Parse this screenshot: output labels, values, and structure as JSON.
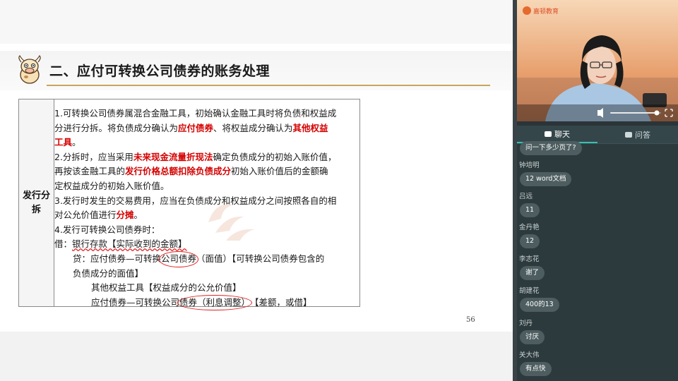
{
  "slide": {
    "title": "二、应付可转换公司债券的账务处理",
    "row_header": "发行分拆",
    "page_number": "56",
    "body": {
      "p1": {
        "a": "1.可转换公司债券属混合金融工具，初始确认金融工具时将负债和权益成",
        "b": "分进行分拆。将负债成分确认为",
        "b_red": "应付债券",
        "b2": "、将权益成分确认为",
        "b_red2": "其他权益",
        "c_red": "工具",
        "c": "。"
      },
      "p2": {
        "a": "2.分拆时，应当采用",
        "a_red": "未来现金流量折现法",
        "a2": "确定负债成分的初始入账价值，",
        "b": "再按该金融工具的",
        "b_red": "发行价格总额扣除负债成分",
        "b2": "初始入账价值后的金额确",
        "c": "定权益成分的初始入账价值。"
      },
      "p3": {
        "a": "3.发行时发生的交易费用，应当在负债成分和权益成分之间按照各自的相",
        "b": "对公允价值进行",
        "b_red": "分摊",
        "b2": "。"
      },
      "p4": {
        "a": "4.发行可转换公司债券时：",
        "b1": "借：",
        "b2": "银行存款【实际收到的金额】",
        "c1": "贷：应付债券—可转换",
        "c2": "公司债券",
        "c3": "（面值）【可转换公司债券包含的",
        "d": "负债成分的面值】",
        "e": "其他权益工具【权益成分的公允价值】",
        "f1": "应付债券—可转换公司",
        "f2": "债券（利息调整）",
        "f3": "【差额，或借】"
      }
    }
  },
  "video": {
    "logo_text": "嘉顿教育"
  },
  "chat": {
    "tabs": [
      {
        "label": "聊天",
        "active": true
      },
      {
        "label": "问答",
        "active": false
      }
    ],
    "messages": [
      {
        "name": "",
        "text": "问一下多少页了?"
      },
      {
        "name": "钟培明",
        "text": "12 word文档"
      },
      {
        "name": "吕远",
        "text": "11"
      },
      {
        "name": "金丹艳",
        "text": "12"
      },
      {
        "name": "李志花",
        "text": "谢了"
      },
      {
        "name": "胡建花",
        "text": "400的13"
      },
      {
        "name": "刘丹",
        "text": "讨厌"
      },
      {
        "name": "关大伟",
        "text": "有点快"
      }
    ]
  },
  "colors": {
    "accent_red": "#d40000",
    "title_rule": "#c8a45a",
    "chat_bg": "#2d3a3d",
    "tab_active": "#39c0b0"
  }
}
